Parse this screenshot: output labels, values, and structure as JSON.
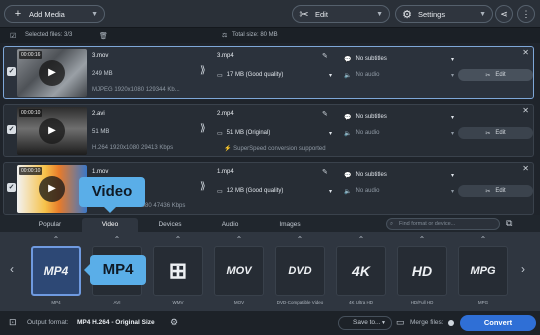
{
  "toolbar": {
    "add_media": "Add Media",
    "edit": "Edit",
    "settings": "Settings"
  },
  "info": {
    "selected": "Selected files: 3/3",
    "total": "Total size: 80 MB"
  },
  "files": [
    {
      "duration": "00:00:16",
      "name": "3.mov",
      "size": "249 MB",
      "codec": "MJPEG 1920x1080 129344 Kb...",
      "out_name": "3.mp4",
      "out_size": "17 MB (Good quality)",
      "subtitles": "No subtitles",
      "audio": "No audio",
      "edit": "Edit",
      "note": ""
    },
    {
      "duration": "00:00:10",
      "name": "2.avi",
      "size": "51 MB",
      "codec": "H.264 1920x1080 29413 Kbps",
      "out_name": "2.mp4",
      "out_size": "51 MB (Original)",
      "subtitles": "No subtitles",
      "audio": "No audio",
      "edit": "Edit",
      "note": "SuperSpeed conversion supported"
    },
    {
      "duration": "00:00:10",
      "name": "1.mov",
      "size": "",
      "codec": "1920x1080 47436 Kbps",
      "out_name": "1.mp4",
      "out_size": "12 MB (Good quality)",
      "subtitles": "No subtitles",
      "audio": "No audio",
      "edit": "Edit",
      "note": ""
    }
  ],
  "tabs": [
    "Popular",
    "Video",
    "Devices",
    "Audio",
    "Images"
  ],
  "search_placeholder": "Find format or device...",
  "formats": [
    {
      "icon": "MP4",
      "label": "MP4"
    },
    {
      "icon": "AVI",
      "label": "AVI"
    },
    {
      "icon": "windows",
      "label": "WMV"
    },
    {
      "icon": "MOV",
      "label": "MOV"
    },
    {
      "icon": "DVD",
      "label": "DVD-Compatible Video"
    },
    {
      "icon": "4K",
      "label": "4K Ultra HD"
    },
    {
      "icon": "HD",
      "label": "HD/Full HD"
    },
    {
      "icon": "MPG",
      "label": "MPG"
    }
  ],
  "tooltips": {
    "tab": "Video",
    "format": "MP4"
  },
  "bottom": {
    "output_label": "Output format:",
    "output_value": "MP4 H.264 - Original Size",
    "save_to": "Save to...",
    "merge": "Merge files:",
    "convert": "Convert"
  },
  "colors": {
    "accent": "#2f6fd6",
    "tooltip": "#5aaee8",
    "selected_format": "#2d4875"
  }
}
